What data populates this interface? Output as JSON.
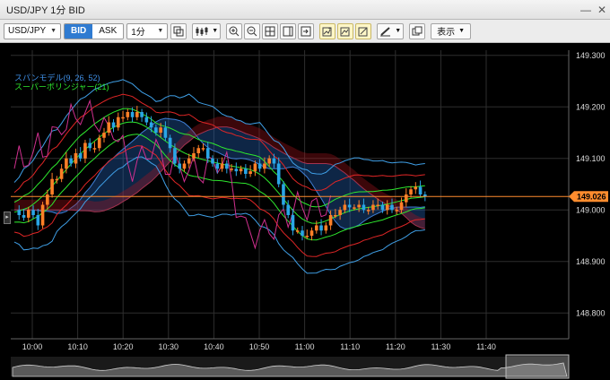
{
  "window": {
    "title": "USD/JPY 1分 BID"
  },
  "toolbar": {
    "pair": "USD/JPY",
    "bid_label": "BID",
    "ask_label": "ASK",
    "timeframe": "1分",
    "display_label": "表示"
  },
  "legend": {
    "span_model": "スパンモデル(9, 26, 52)",
    "super_bollinger": "スーパーボリンジャー(21)"
  },
  "colors": {
    "span_model_text": "#3f8fe6",
    "super_bollinger_text": "#2ee82e",
    "candle_up": "#ff7f27",
    "candle_down": "#2aa6e6",
    "current_price": "#ff8c2e",
    "bid_active": "#2f7bd1"
  },
  "price_axis": {
    "ticks": [
      "149.300",
      "149.200",
      "149.100",
      "149.000",
      "148.900",
      "148.800"
    ],
    "current_price": "149.026"
  },
  "time_axis": {
    "ticks": [
      "10:00",
      "10:10",
      "10:20",
      "10:30",
      "10:40",
      "10:50",
      "11:00",
      "11:10",
      "11:20",
      "11:30",
      "11:40"
    ]
  },
  "chart_data": {
    "type": "candlestick",
    "interval": "1分",
    "y_range": [
      148.75,
      149.31
    ],
    "y_ticks": [
      149.3,
      149.2,
      149.1,
      149.0,
      148.9,
      148.8
    ],
    "x_ticks": [
      "10:00",
      "10:10",
      "10:20",
      "10:30",
      "10:40",
      "10:50",
      "11:00",
      "11:10",
      "11:20",
      "11:30",
      "11:40"
    ],
    "current_price": 149.026,
    "price_path": [
      149.0,
      148.99,
      148.985,
      149.0,
      148.99,
      148.97,
      149.01,
      149.03,
      149.06,
      149.06,
      149.08,
      149.1,
      149.09,
      149.11,
      149.1,
      149.13,
      149.12,
      149.12,
      149.14,
      149.15,
      149.17,
      149.16,
      149.18,
      149.18,
      149.19,
      149.18,
      149.19,
      149.18,
      149.17,
      149.16,
      149.15,
      149.16,
      149.14,
      149.12,
      149.09,
      149.08,
      149.09,
      149.1,
      149.11,
      149.12,
      149.12,
      149.1,
      149.09,
      149.08,
      149.09,
      149.08,
      149.08,
      149.075,
      149.08,
      149.07,
      149.075,
      149.09,
      149.08,
      149.09,
      149.1,
      149.09,
      149.05,
      149.01,
      148.99,
      148.96,
      148.96,
      148.95,
      148.95,
      148.96,
      148.97,
      148.96,
      148.97,
      148.99,
      148.99,
      149.0,
      149.01,
      149.005,
      149.005,
      149.01,
      149.0,
      149.0,
      149.01,
      149.01,
      149.0,
      149.01,
      149.0,
      149.0,
      149.015,
      149.03,
      149.04,
      149.045,
      149.03,
      149.026
    ],
    "series": [
      {
        "name": "スパンモデル(9, 26, 52)"
      },
      {
        "name": "スーパーボリンジャー(21)"
      }
    ],
    "legend_position": "top-left",
    "grid": true
  }
}
